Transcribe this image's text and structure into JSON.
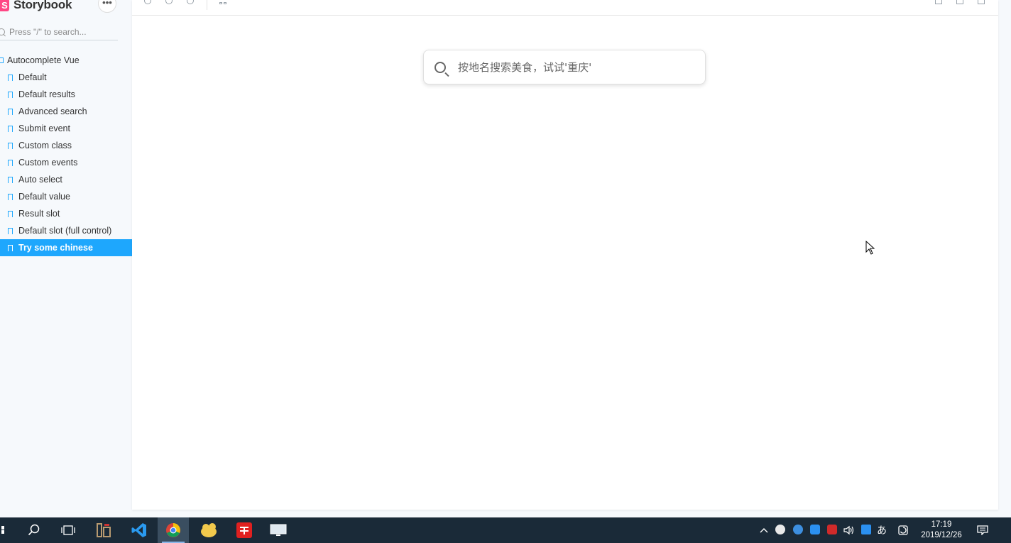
{
  "sidebar": {
    "brand": "Storybook",
    "brand_logo_letter": "S",
    "menu_label": "•••",
    "search_placeholder": "Press \"/\" to search...",
    "group": "Autocomplete Vue",
    "items": [
      {
        "label": "Default"
      },
      {
        "label": "Default results"
      },
      {
        "label": "Advanced search"
      },
      {
        "label": "Submit event"
      },
      {
        "label": "Custom class"
      },
      {
        "label": "Custom events"
      },
      {
        "label": "Auto select"
      },
      {
        "label": "Default value"
      },
      {
        "label": "Result slot"
      },
      {
        "label": "Default slot (full control)"
      },
      {
        "label": "Try some chinese"
      }
    ],
    "active_index": 10
  },
  "canvas": {
    "search_placeholder": "按地名搜索美食，试试'重庆'"
  },
  "taskbar": {
    "time": "17:19",
    "date": "2019/12/26",
    "ime_label": "あ"
  },
  "colors": {
    "accent": "#1ea7fd",
    "brand": "#ff4785",
    "taskbar": "#1a2a38"
  }
}
